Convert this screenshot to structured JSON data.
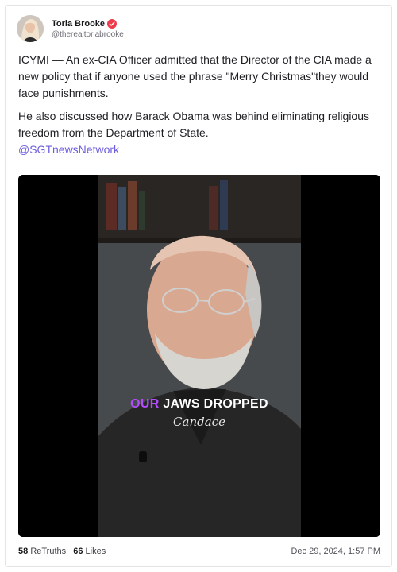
{
  "post": {
    "author": {
      "name": "Toria Brooke",
      "handle": "@therealtoriabrooke",
      "verified_icon": "verified-badge-icon",
      "verified_color": "#ec3c4b"
    },
    "paragraph_1": "ICYMI — An ex-CIA Officer admitted that the Director of the CIA made a new policy that if anyone used the phrase \"Merry Christmas\"they would face punishments.",
    "paragraph_2": "He also discussed how Barack Obama was behind eliminating religious freedom from the Department of State.",
    "mention": "@SGTnewsNetwork",
    "mention_color": "#6d5ee0",
    "video": {
      "caption_accent": "OUR",
      "caption_rest": "JAWS DROPPED",
      "caption_accent_color": "#b44bff",
      "signature": "Candace"
    },
    "stats": {
      "retruths_count": "58",
      "retruths_label": "ReTruths",
      "likes_count": "66",
      "likes_label": "Likes"
    },
    "timestamp": "Dec 29, 2024, 1:57 PM"
  }
}
